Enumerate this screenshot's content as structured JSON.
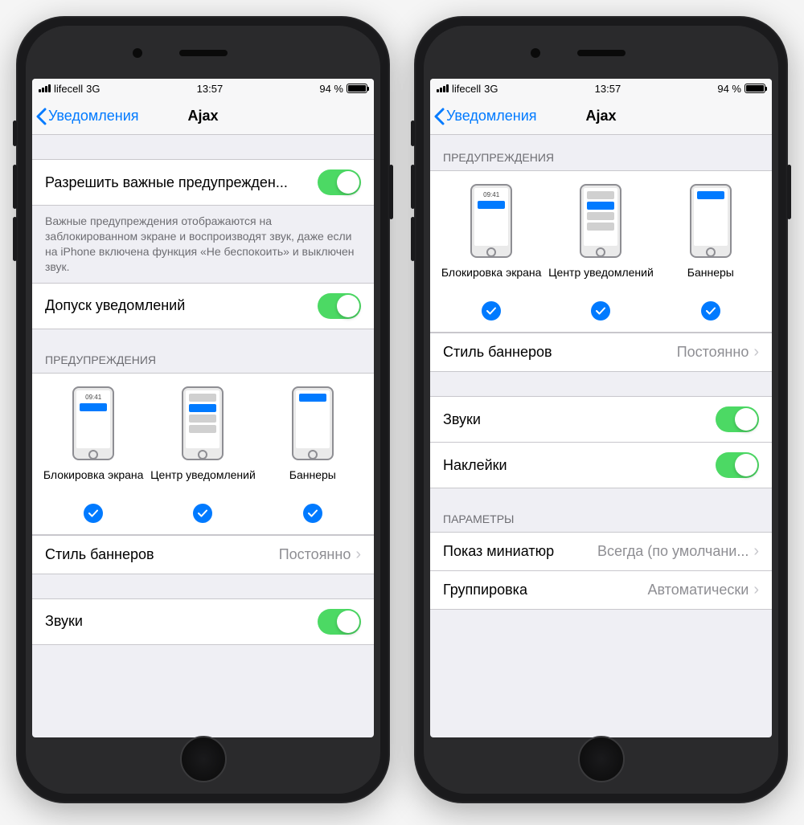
{
  "status": {
    "carrier": "lifecell",
    "network": "3G",
    "time": "13:57",
    "battery_pct": "94 %"
  },
  "nav": {
    "back": "Уведомления",
    "title": "Ajax"
  },
  "left": {
    "critical_alerts": {
      "label": "Разрешить важные предупрежден...",
      "footer": "Важные предупреждения отображаются на заблокированном экране и воспроизводят звук, даже если на iPhone включена функция «Не беспокоить» и выключен звук."
    },
    "allow_notifications": {
      "label": "Допуск уведомлений"
    },
    "alerts_header": "ПРЕДУПРЕЖДЕНИЯ",
    "alert_types": {
      "lock": "Блокировка экрана",
      "center": "Центр уведомлений",
      "banner": "Баннеры",
      "preview_time": "09:41"
    },
    "banner_style": {
      "label": "Стиль баннеров",
      "value": "Постоянно"
    },
    "sounds": {
      "label": "Звуки"
    }
  },
  "right": {
    "alerts_header": "ПРЕДУПРЕЖДЕНИЯ",
    "alert_types": {
      "lock": "Блокировка экрана",
      "center": "Центр уведомлений",
      "banner": "Баннеры",
      "preview_time": "09:41"
    },
    "banner_style": {
      "label": "Стиль баннеров",
      "value": "Постоянно"
    },
    "sounds": {
      "label": "Звуки"
    },
    "badges": {
      "label": "Наклейки"
    },
    "options_header": "ПАРАМЕТРЫ",
    "previews": {
      "label": "Показ миниатюр",
      "value": "Всегда (по умолчани..."
    },
    "grouping": {
      "label": "Группировка",
      "value": "Автоматически"
    }
  }
}
